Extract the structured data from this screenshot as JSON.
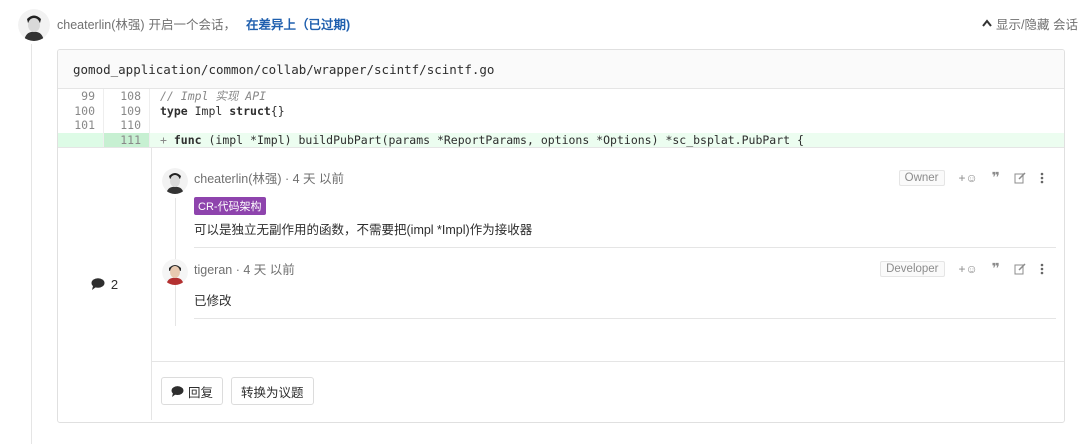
{
  "header": {
    "author": "cheaterlin(林强)",
    "action": "开启一个会话，",
    "link": "在差异上（已过期)",
    "toggle_label": "显示/隐藏 会话"
  },
  "file": {
    "path": "gomod_application/common/collab/wrapper/scintf/scintf.go"
  },
  "diff_rows": [
    {
      "old": "99",
      "new": "108"
    },
    {
      "old": "100",
      "new": "109"
    },
    {
      "old": "101",
      "new": "110"
    },
    {
      "old": "",
      "new": "111"
    }
  ],
  "code": {
    "line1": "// Impl 实现 API",
    "line2_kw": "type",
    "line2_a": " Impl ",
    "line2_kw2": "struct",
    "line2_b": "{}",
    "line4_plus": "+ ",
    "line4_kw": "func",
    "line4_rest": " (impl *Impl) buildPubPart(params *ReportParams, options *Options) *sc_bsplat.PubPart {"
  },
  "discussion": {
    "count": "2"
  },
  "notes": [
    {
      "author": "cheaterlin(林强) · 4 天 以前",
      "role": "Owner",
      "label": "CR-代码架构",
      "body": "可以是独立无副作用的函数，不需要把(impl *Impl)作为接收器"
    },
    {
      "author": "tigeran · 4 天 以前",
      "role": "Developer",
      "body": "已修改"
    }
  ],
  "tools": {
    "emoji": "+☺",
    "quote": "❞"
  },
  "reply": {
    "reply_label": "回复",
    "convert_label": "转换为议题"
  }
}
